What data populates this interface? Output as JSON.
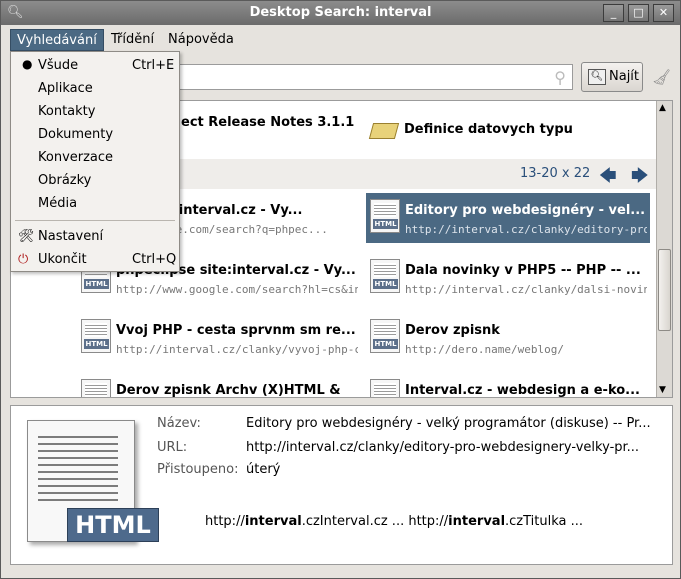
{
  "window": {
    "title": "Desktop Search: interval",
    "controls": {
      "minimize": "_",
      "maximize": "□",
      "close": "✕"
    }
  },
  "menubar": {
    "items": [
      {
        "label": "Vyhledávání"
      },
      {
        "label": "Třídění"
      },
      {
        "label": "Nápověda"
      }
    ]
  },
  "search": {
    "value": "",
    "find_label": "Najít"
  },
  "dropdown": {
    "items": [
      {
        "label": "Všude",
        "accel": "Ctrl+E",
        "selected": true
      },
      {
        "label": "Aplikace"
      },
      {
        "label": "Kontakty"
      },
      {
        "label": "Dokumenty"
      },
      {
        "label": "Konverzace"
      },
      {
        "label": "Obrázky"
      },
      {
        "label": "Média"
      },
      {
        "label": "Nastavení",
        "icon": "tools-icon"
      },
      {
        "label": "Ukončit",
        "accel": "Ctrl+Q",
        "icon": "exit-icon"
      }
    ]
  },
  "results": {
    "top_partial": "ect Release Notes 3.1.1",
    "top_category": "Definice datovych typu",
    "pager_partial": "y",
    "pager": "13-20 x 22",
    "items": [
      {
        "title": "hse site:interval.cz - Vy...",
        "url": "www.google.com/search?q=phpec...",
        "selected": false
      },
      {
        "title": "Editory pro webdesignéry - vel...",
        "url": "http://interval.cz/clanky/editory-pro-web...",
        "selected": true
      },
      {
        "title": "phpeclipse site:interval.cz - Vy...",
        "url": "http://www.google.com/search?hl=cs&inl...",
        "selected": false
      },
      {
        "title": "Dala novinky v PHP5 -- PHP -- ...",
        "url": "http://interval.cz/clanky/dalsi-novinky-v...",
        "selected": false
      },
      {
        "title": "Vvoj PHP - cesta sprvnm sm re...",
        "url": "http://interval.cz/clanky/vyvoj-php-cest...",
        "selected": false
      },
      {
        "title": "Derov zpisnk",
        "url": "http://dero.name/weblog/",
        "selected": false
      },
      {
        "title": "Derov zpisnk  Archv  (X)HTML &",
        "url": "",
        "selected": false
      },
      {
        "title": "Interval.cz - webdesign a e-ko...",
        "url": "",
        "selected": false
      }
    ]
  },
  "details": {
    "badge": "HTML",
    "name_label": "Název:",
    "name_value": "Editory pro webdesignéry - velký programátor (diskuse) -- Pr...",
    "url_label": "URL:",
    "url_value": "http://interval.cz/clanky/editory-pro-webdesignery-velky-pr...",
    "accessed_label": "Přistoupeno:",
    "accessed_value": "úterý",
    "snippet_a_pre": "http://",
    "snippet_a_bold": "interval",
    "snippet_a_post": ".czInterval.cz  ... http://",
    "snippet_b_bold": "interval",
    "snippet_b_post": ".czTitulka ..."
  }
}
